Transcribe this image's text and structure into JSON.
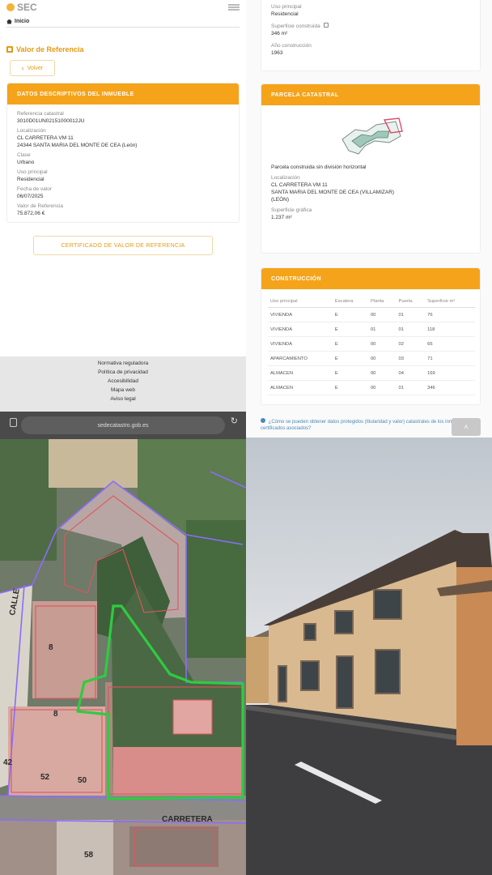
{
  "app": {
    "logo_text": "SEC"
  },
  "nav": {
    "home_label": "Inicio"
  },
  "page": {
    "title": "Valor de Referencia",
    "back_label": "Volver"
  },
  "datos": {
    "header": "DATOS DESCRIPTIVOS DEL INMUEBLE",
    "fields": [
      {
        "label": "Referencia catastral",
        "value": "3010D01UN02151000012JU"
      },
      {
        "label": "Localización",
        "value": "CL CARRETERA VM 11",
        "value2": "24344 SANTA MARIA DEL MONTE DE CEA (León)"
      },
      {
        "label": "Clase",
        "value": "Urbano"
      },
      {
        "label": "Uso principal",
        "value": "Residencial"
      },
      {
        "label": "Fecha de valor",
        "value": "06/07/2025"
      },
      {
        "label": "Valor de Referencia",
        "value": "75.872,06 €"
      }
    ],
    "cert_button": "CERTIFICADO DE VALOR DE REFERENCIA"
  },
  "right_top": {
    "fields": [
      {
        "label": "Uso principal",
        "value": "Residencial"
      },
      {
        "label": "Superficie construida",
        "value": "346 m²"
      },
      {
        "label": "Año construcción",
        "value": "1963"
      }
    ]
  },
  "parcela": {
    "header": "PARCELA CATASTRAL",
    "desc": "Parcela construida sin división horizontal",
    "loc_label": "Localización",
    "loc_value": "CL CARRETERA VM 11",
    "loc_value2": "SANTA MARIA DEL MONTE DE CEA (VILLAMIZAR)",
    "loc_value3": "(LEÓN)",
    "surf_label": "Superficie gráfica",
    "surf_value": "1.237 m²"
  },
  "construccion": {
    "header": "CONSTRUCCIÓN",
    "columns": [
      "Uso principal",
      "Escalera",
      "Planta",
      "Puerta",
      "Superficie m²"
    ],
    "rows": [
      [
        "VIVIENDA",
        "E",
        "00",
        "01",
        "76"
      ],
      [
        "VIVIENDA",
        "E",
        "01",
        "01",
        "118"
      ],
      [
        "VIVIENDA",
        "E",
        "00",
        "02",
        "66"
      ],
      [
        "APARCAMIENTO",
        "E",
        "00",
        "03",
        "71"
      ],
      [
        "ALMACEN",
        "E",
        "00",
        "04",
        "169"
      ],
      [
        "ALMACEN",
        "E",
        "00",
        "01",
        "346"
      ]
    ],
    "info_text": "¿Cómo se pueden obtener datos protegidos (titularidad y valor) catastrales de los inmuebles y certificados asociados?"
  },
  "footer": {
    "links": [
      "Normativa reguladora",
      "Política de privacidad",
      "Accesibilidad",
      "Mapa web",
      "Aviso legal"
    ]
  },
  "browser": {
    "url": "sedecatastro.gob.es"
  },
  "map": {
    "labels": [
      "CALLE",
      "CARRETERA",
      "42",
      "50",
      "58",
      "52",
      "8",
      "8"
    ]
  },
  "colors": {
    "accent": "#f5a31a",
    "link": "#4a8ab5",
    "parcel_outline": "#2ecc40",
    "cadastre_lines": "#7a5cff"
  }
}
